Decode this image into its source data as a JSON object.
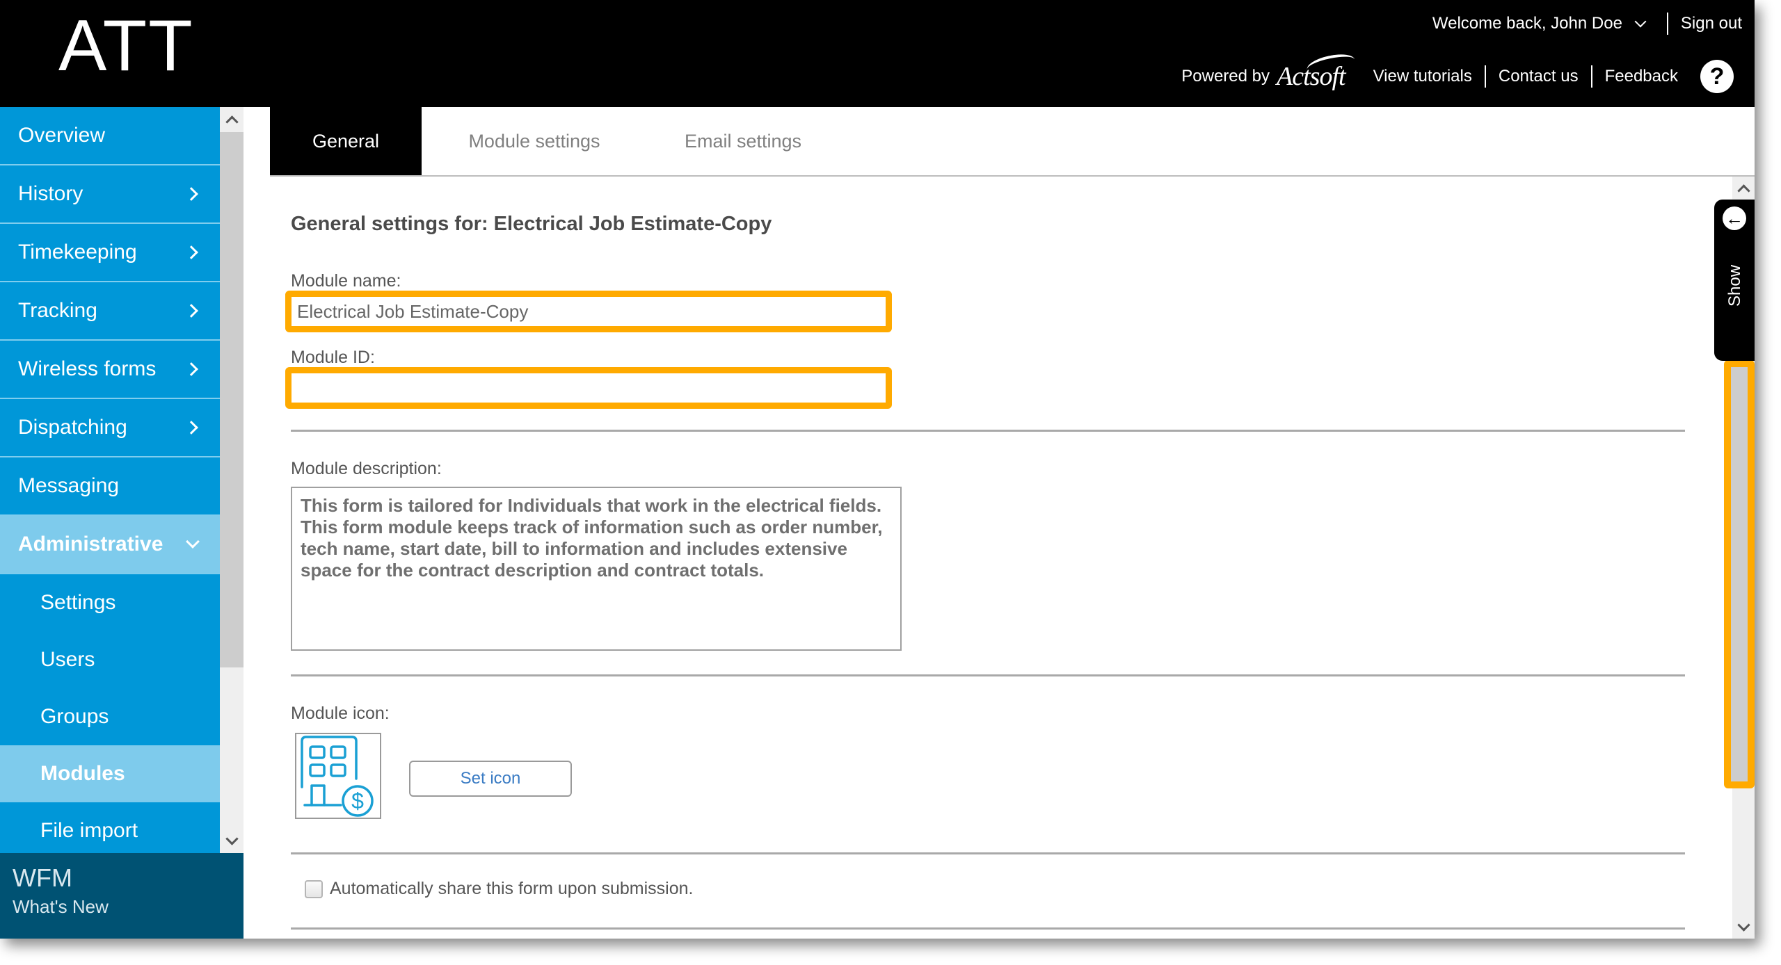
{
  "header": {
    "logo": "ATT",
    "welcome": "Welcome back, John Doe",
    "sign_out": "Sign out",
    "powered_by": "Powered by",
    "powered_brand": "Actsoft",
    "links": [
      "View tutorials",
      "Contact us",
      "Feedback"
    ],
    "help": "?"
  },
  "sidebar": {
    "items": [
      {
        "label": "Overview",
        "has_submenu": false
      },
      {
        "label": "History",
        "has_submenu": true
      },
      {
        "label": "Timekeeping",
        "has_submenu": true
      },
      {
        "label": "Tracking",
        "has_submenu": true
      },
      {
        "label": "Wireless forms",
        "has_submenu": true
      },
      {
        "label": "Dispatching",
        "has_submenu": true
      },
      {
        "label": "Messaging",
        "has_submenu": false
      },
      {
        "label": "Administrative",
        "has_submenu": true,
        "expanded": true
      }
    ],
    "sub_items": [
      {
        "label": "Settings"
      },
      {
        "label": "Users"
      },
      {
        "label": "Groups"
      },
      {
        "label": "Modules",
        "active": true
      },
      {
        "label": "File import"
      }
    ],
    "footer": {
      "title": "WFM",
      "link": "What's New"
    }
  },
  "tabs": [
    {
      "label": "General",
      "active": true
    },
    {
      "label": "Module settings",
      "active": false
    },
    {
      "label": "Email settings",
      "active": false
    }
  ],
  "general": {
    "title": "General settings for: Electrical Job Estimate-Copy",
    "module_name_label": "Module name:",
    "module_name_value": "Electrical Job Estimate-Copy",
    "module_id_label": "Module ID:",
    "module_id_value": "",
    "description_label": "Module description:",
    "description_value": "This form is tailored for Individuals that work in the electrical fields. This form module keeps track of information such as order number, tech name, start date, bill to information and includes extensive space for the contract description and contract totals.",
    "icon_label": "Module icon:",
    "icon_name": "building-dollar-icon",
    "set_icon_button": "Set icon",
    "auto_share_label": "Automatically share this form upon submission.",
    "auto_share_checked": false
  },
  "side_panel": {
    "label": "Show"
  },
  "colors": {
    "sidebar": "#0097d8",
    "sidebar_active": "#7ecbec",
    "footer": "#005273",
    "highlight": "#ffaa00",
    "header": "#000000",
    "link_blue": "#3b7cc4"
  }
}
